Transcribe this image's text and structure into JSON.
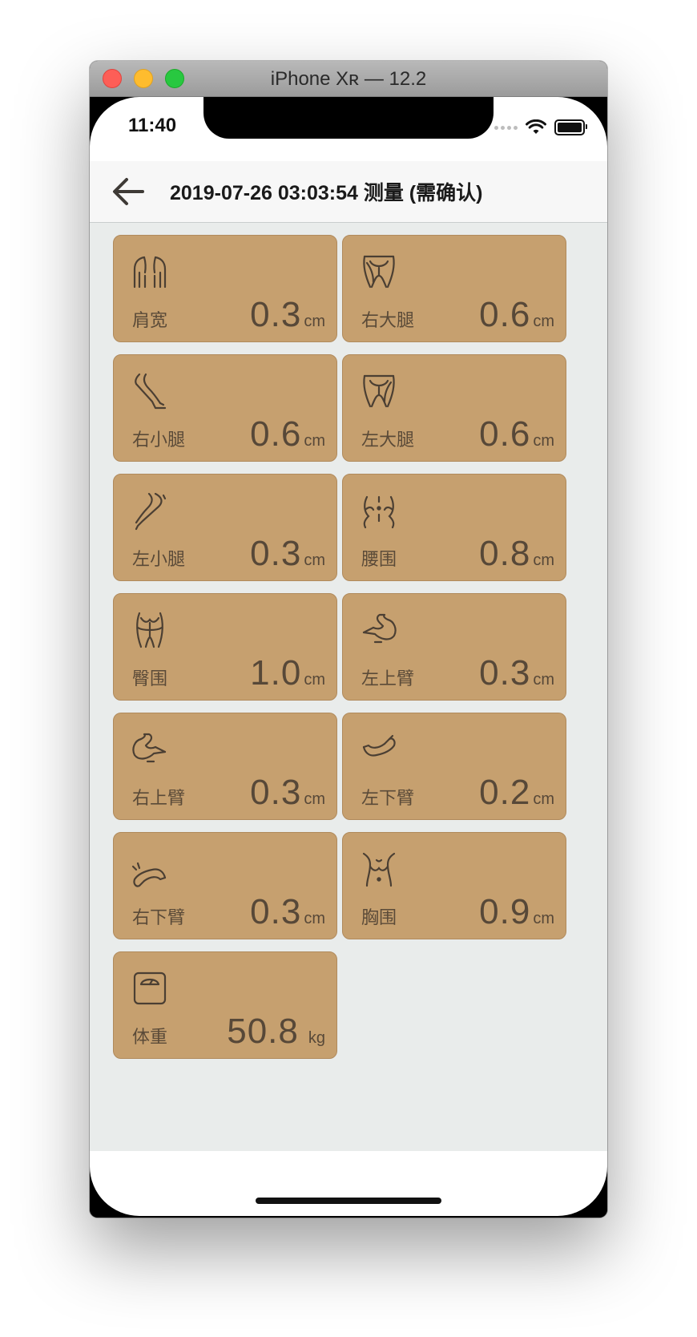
{
  "window": {
    "title": "iPhone Xʀ — 12.2"
  },
  "status_bar": {
    "time": "11:40"
  },
  "nav": {
    "title": "2019-07-26 03:03:54 测量 (需确认)"
  },
  "colors": {
    "card_bg": "#c6a06f",
    "content_bg": "#e9eceb",
    "text": "#574838"
  },
  "measurements": [
    {
      "label": "肩宽",
      "value": "0.3",
      "unit": "cm",
      "icon": "shoulder-icon"
    },
    {
      "label": "右大腿",
      "value": "0.6",
      "unit": "cm",
      "icon": "right-thigh-icon"
    },
    {
      "label": "右小腿",
      "value": "0.6",
      "unit": "cm",
      "icon": "right-calf-icon"
    },
    {
      "label": "左大腿",
      "value": "0.6",
      "unit": "cm",
      "icon": "left-thigh-icon"
    },
    {
      "label": "左小腿",
      "value": "0.3",
      "unit": "cm",
      "icon": "left-calf-icon"
    },
    {
      "label": "腰围",
      "value": "0.8",
      "unit": "cm",
      "icon": "waist-icon"
    },
    {
      "label": "臀围",
      "value": "1.0",
      "unit": "cm",
      "icon": "hip-icon"
    },
    {
      "label": "左上臂",
      "value": "0.3",
      "unit": "cm",
      "icon": "left-upper-arm-icon"
    },
    {
      "label": "右上臂",
      "value": "0.3",
      "unit": "cm",
      "icon": "right-upper-arm-icon"
    },
    {
      "label": "左下臂",
      "value": "0.2",
      "unit": "cm",
      "icon": "left-forearm-icon"
    },
    {
      "label": "右下臂",
      "value": "0.3",
      "unit": "cm",
      "icon": "right-forearm-icon"
    },
    {
      "label": "胸围",
      "value": "0.9",
      "unit": "cm",
      "icon": "chest-icon"
    },
    {
      "label": "体重",
      "value": "50.8",
      "unit": "kg",
      "icon": "scale-icon"
    }
  ]
}
